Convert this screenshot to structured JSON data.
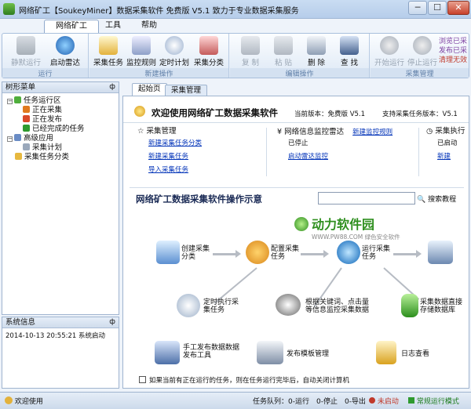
{
  "window": {
    "title": "网络矿工【SoukeyMiner】数据采集软件 免费版 V5.1 致力于专业数据采集服务",
    "min": "─",
    "max": "☐",
    "close": "✕"
  },
  "menu": [
    "网络矿工",
    "工具",
    "帮助"
  ],
  "ribbon": {
    "groups": [
      {
        "label": "运行",
        "buttons": [
          {
            "label": "静默运行",
            "icon": "silent-run-icon",
            "enabled": false
          },
          {
            "label": "启动雷达",
            "icon": "radar-icon",
            "enabled": true
          }
        ]
      },
      {
        "label": "新建操作",
        "buttons": [
          {
            "label": "采集任务",
            "icon": "task-icon",
            "enabled": true
          },
          {
            "label": "监控规则",
            "icon": "monitor-icon",
            "enabled": true
          },
          {
            "label": "定时计划",
            "icon": "clock-icon",
            "enabled": true
          },
          {
            "label": "采集分类",
            "icon": "category-icon",
            "enabled": true
          }
        ]
      },
      {
        "label": "编辑操作",
        "buttons": [
          {
            "label": "复 制",
            "icon": "copy-icon",
            "enabled": false
          },
          {
            "label": "粘 贴",
            "icon": "paste-icon",
            "enabled": false
          },
          {
            "label": "删 除",
            "icon": "delete-icon",
            "enabled": true
          },
          {
            "label": "查 找",
            "icon": "find-icon",
            "enabled": true
          }
        ]
      },
      {
        "label": "采集管理",
        "buttons": [
          {
            "label": "开始运行",
            "icon": "play-icon",
            "enabled": false
          },
          {
            "label": "停止运行",
            "icon": "stop-icon",
            "enabled": false
          }
        ]
      }
    ],
    "side_links": [
      "浏览已采",
      "发布已采",
      "清理无效"
    ]
  },
  "tree": {
    "title": "树形菜单",
    "pin": "ф",
    "nodes": [
      {
        "label": "任务运行区",
        "level": 0,
        "expander": "−"
      },
      {
        "label": "正在采集",
        "level": 1
      },
      {
        "label": "正在发布",
        "level": 1
      },
      {
        "label": "已经完成的任务",
        "level": 1
      },
      {
        "label": "高级应用",
        "level": 0,
        "expander": "−"
      },
      {
        "label": "采集计划",
        "level": 1
      },
      {
        "label": "采集任务分类",
        "level": 0
      }
    ]
  },
  "log": {
    "title": "系统信息",
    "pin": "ф",
    "entry": "2014-10-13 20:55:21 系统启动"
  },
  "tabs": [
    "起始页",
    "采集管理"
  ],
  "welcome": {
    "title": "欢迎使用网络矿工数据采集软件",
    "current_version": "当前版本：免费版 V5.1",
    "supported": "支持采集任务版本：V5.1"
  },
  "panels": [
    {
      "title": "采集管理",
      "links": [
        "新建采集任务分类",
        "新建采集任务",
        "导入采集任务"
      ]
    },
    {
      "title": "网络信息监控雷达",
      "status": "已停止",
      "link_top": "新建监控规则",
      "link": "启动雷达监控"
    },
    {
      "title": "采集执行",
      "status": "已启动",
      "link": "新建"
    }
  ],
  "demo": {
    "title": "网络矿工数据采集软件操作示意",
    "search_placeholder": "",
    "search_button": "搜索教程",
    "watermark": "动力软件园",
    "watermark_sub": "WWW.PW88.COM 绿色安全软件",
    "steps": [
      "创建采集分类",
      "配置采集任务",
      "运行采集任务",
      "",
      "定时执行采集任务",
      "根据关键词、点击量等信息监控采集数据",
      "采集数据直接存储数据库",
      "手工发布数据数据发布工具",
      "发布模板管理",
      "日志查看"
    ],
    "checkbox": "如果当前有正在运行的任务，则在任务运行完毕后，自动关闭计算机"
  },
  "status": {
    "welcome": "欢迎使用",
    "queue": "任务队列：0-运行　0-停止　0-导出",
    "radar": "未启动",
    "mode": "常规运行模式"
  },
  "colors": {
    "accent": "#0032b8",
    "radar_off": "#c0392b"
  }
}
